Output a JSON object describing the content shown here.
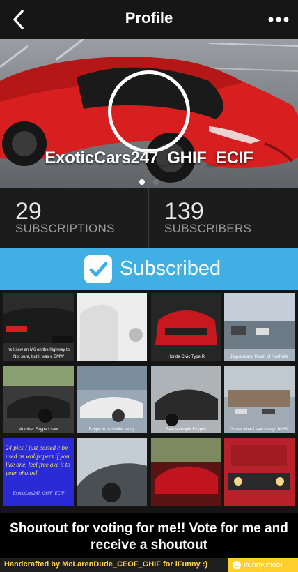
{
  "header": {
    "title": "Profile",
    "back_icon": "chevron-left-icon",
    "more_icon": "more-horizontal-icon"
  },
  "profile": {
    "username": "ExoticCars247_GHIF_ECIF",
    "cover_page_count": 2,
    "cover_active_page": 1
  },
  "stats": {
    "subscriptions": {
      "count": "29",
      "label": "SUBSCRIPTIONS"
    },
    "subscribers": {
      "count": "139",
      "label": "SUBSCRIBERS"
    }
  },
  "subscribe": {
    "label": "Subscribed",
    "icon": "checkmark-icon",
    "color": "#40b0e4"
  },
  "posts": [
    {
      "caption": "nk I saw an M6 on the highway to",
      "caption2": "Not sure, but it was a BMW",
      "color": "#2b2b2b"
    },
    {
      "caption": "",
      "caption2": "",
      "color": "#e6e6e6"
    },
    {
      "caption": "Honda Civic Type R",
      "caption2": "",
      "color": "#262626"
    },
    {
      "caption": "Jaguar/Land Rover of Nashville",
      "caption2": "",
      "color": "#a7b3bf"
    },
    {
      "caption": "Another F-type I saw",
      "caption2": "",
      "color": "#3a3a3a"
    },
    {
      "caption": "F-type in Nashville today",
      "caption2": "",
      "color": "#9aa7b4"
    },
    {
      "caption": "Saw a couple F-types",
      "caption2": "",
      "color": "#aeb3b8"
    },
    {
      "caption": "Guess what I saw today! JAGS!",
      "caption2": "",
      "color": "#9faab4"
    },
    {
      "caption": "24 pics I just posted c be used as wallpapers if you like one, feel free ave it to your photos!",
      "caption2": "ExoticCars247_GHIF_ECIF",
      "color": "#2a2ad6"
    },
    {
      "caption": "",
      "caption2": "",
      "color": "#c4ccd4"
    },
    {
      "caption": "",
      "caption2": "",
      "color": "#5a1414"
    },
    {
      "caption": "",
      "caption2": "",
      "color": "#b8202a"
    }
  ],
  "shoutout": {
    "line1": "Shoutout for voting for me!! Vote for me and",
    "line2": "receive a shoutout"
  },
  "footer": {
    "credit": "Handcrafted by McLarenDude_CEOF_GHIF for iFunny :)",
    "badge": "ifunny.mobi"
  }
}
